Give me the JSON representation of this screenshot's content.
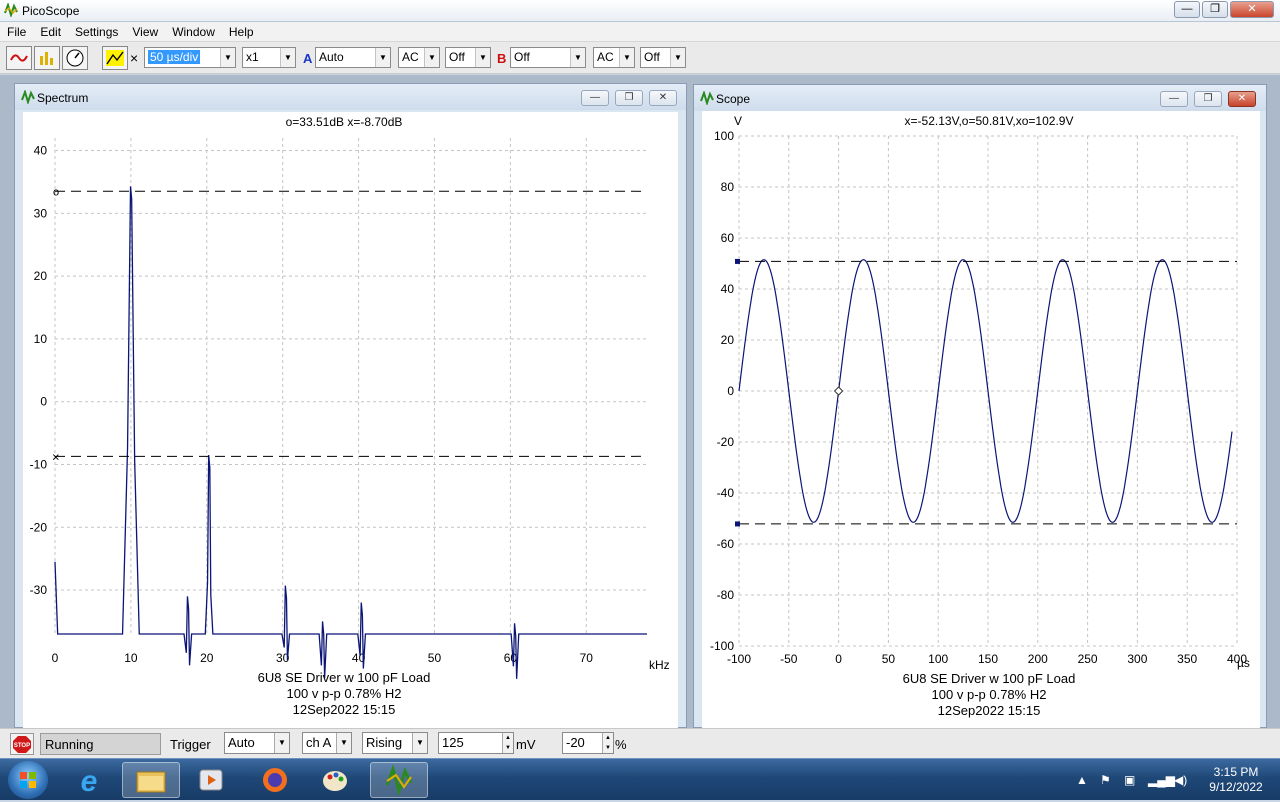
{
  "app": {
    "title": "PicoScope"
  },
  "menu": [
    "File",
    "Edit",
    "Settings",
    "View",
    "Window",
    "Help"
  ],
  "toolbar": {
    "x_symbol": "×",
    "timebase": "50 µs/div",
    "multiplier": "x1",
    "channel_a": {
      "label": "A",
      "range": "Auto",
      "coupling": "AC",
      "offset": "Off"
    },
    "channel_b": {
      "label": "B",
      "range": "Off",
      "coupling": "AC",
      "offset": "Off"
    },
    "colors": {
      "channel_a": "#1a35c8",
      "channel_b": "#cc1010"
    }
  },
  "spectrum": {
    "title": "Spectrum",
    "readout": "o=33.51dB  x=-8.70dB",
    "x_unit": "kHz",
    "marker_o_label": "o",
    "marker_x_label": "×",
    "caption": [
      "6U8 SE Driver w 100 pF Load",
      "100 v p-p 0.78% H2",
      "12Sep2022  15:15"
    ]
  },
  "scope": {
    "title": "Scope",
    "y_unit": "V",
    "readout": "x=-52.13V,o=50.81V,xo=102.9V",
    "x_unit": "µs",
    "caption": [
      "6U8 SE Driver w 100 pF Load",
      "100 v p-p 0.78% H2",
      "12Sep2022  15:15"
    ]
  },
  "chart_data": [
    {
      "type": "line",
      "name": "spectrum",
      "xlim": [
        0,
        78
      ],
      "ylim": [
        -37,
        42
      ],
      "x_ticks": [
        0,
        10,
        20,
        30,
        40,
        50,
        60,
        70
      ],
      "y_ticks": [
        40,
        30,
        20,
        10,
        0,
        -10,
        -20,
        -30
      ],
      "grid": true,
      "floor_db": -37,
      "peaks": [
        {
          "x": 0,
          "y": -25.5
        },
        {
          "x": 10,
          "y": 34.3
        },
        {
          "x": 17.5,
          "y": -31
        },
        {
          "x": 20.3,
          "y": -8.5
        },
        {
          "x": 30.4,
          "y": -29.3
        },
        {
          "x": 35.3,
          "y": -35
        },
        {
          "x": 40.4,
          "y": -32
        },
        {
          "x": 60.6,
          "y": -35.3
        }
      ],
      "cursor_o": 33.51,
      "cursor_x": -8.7
    },
    {
      "type": "line",
      "name": "scope",
      "xlim": [
        -100,
        400
      ],
      "ylim": [
        -100,
        100
      ],
      "x_ticks": [
        -100,
        -50,
        0,
        50,
        100,
        150,
        200,
        250,
        300,
        350,
        400
      ],
      "y_ticks": [
        100,
        80,
        60,
        40,
        20,
        0,
        -20,
        -40,
        -60,
        -80,
        -100
      ],
      "grid": true,
      "signal": {
        "amplitude_v": 51.5,
        "frequency_khz": 10
      },
      "trigger_point": {
        "x": 0,
        "y": 0
      },
      "cursor_o": 50.81,
      "cursor_x": -52.13
    }
  ],
  "status": {
    "stop_label": "STOP",
    "state": "Running",
    "trigger_label": "Trigger",
    "trigger_mode": "Auto",
    "trigger_channel": "ch A",
    "trigger_edge": "Rising",
    "trigger_level": "125",
    "level_unit": "mV",
    "pretrigger": "-20",
    "pretrigger_unit": "%"
  },
  "taskbar": {
    "time": "3:15 PM",
    "date": "9/12/2022"
  }
}
